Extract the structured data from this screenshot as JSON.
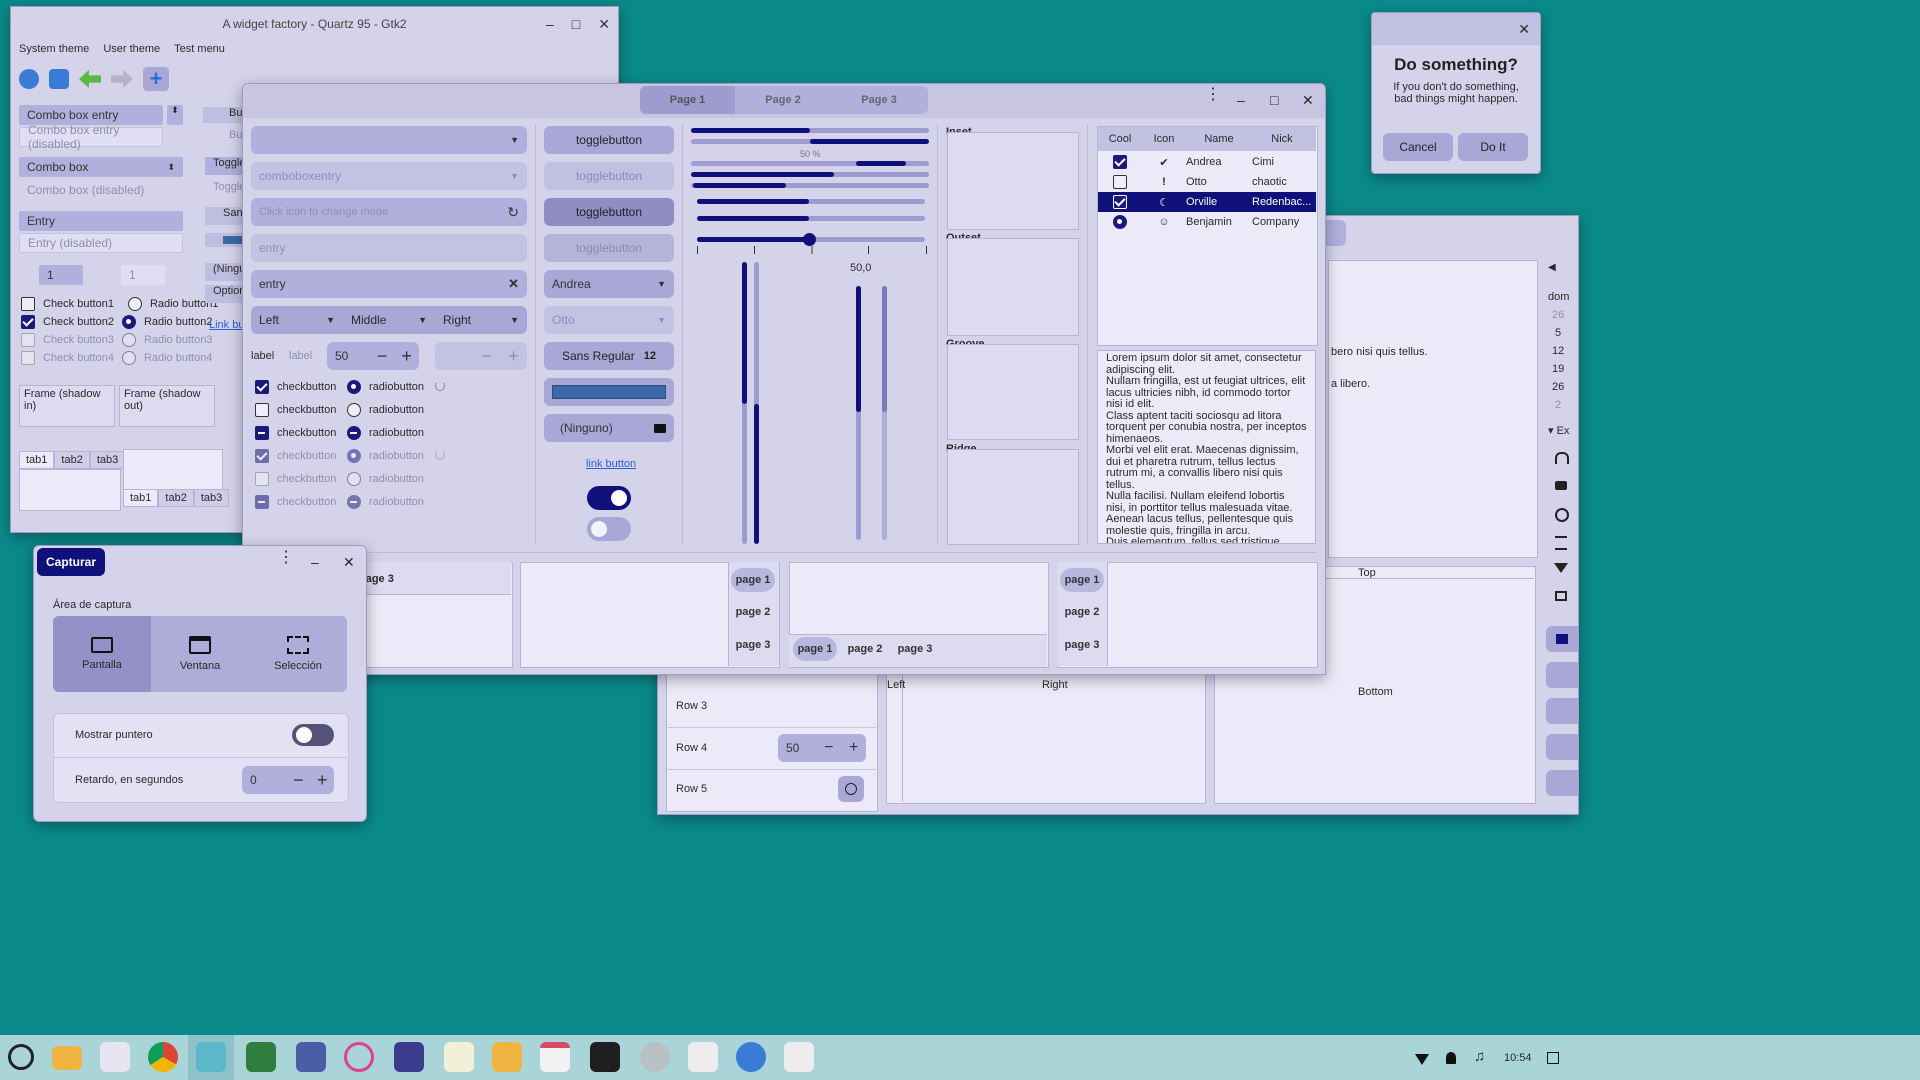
{
  "widget_factory": {
    "title": "A widget factory - Quartz 95 - Gtk2",
    "menu": [
      "System theme",
      "User theme",
      "Test menu"
    ],
    "combo_entry": "Combo box entry",
    "combo_entry_dis": "Combo box entry (disabled)",
    "combo": "Combo box",
    "combo_dis": "Combo box (disabled)",
    "entry": "Entry",
    "entry_dis": "Entry (disabled)",
    "spin1": "1",
    "spin2": "1",
    "checks": [
      "Check button1",
      "Check button2",
      "Check button3",
      "Check button4"
    ],
    "radios": [
      "Radio button1",
      "Radio button2",
      "Radio button3",
      "Radio button4"
    ],
    "frame_in": "Frame (shadow in)",
    "frame_out": "Frame (shadow out)",
    "tabs": [
      "tab1",
      "tab2",
      "tab3"
    ],
    "partial": [
      "Bu",
      "Bu",
      "Toggle",
      "Toggle",
      "San",
      "(Ningu",
      "Option",
      "Link bu"
    ]
  },
  "gtk4": {
    "tabs": [
      "Page 1",
      "Page 2",
      "Page 3"
    ],
    "col1": {
      "comboboxentry": "comboboxentry",
      "icon_entry_placeholder": "Click icon to change mode",
      "entry_placeholder": "entry",
      "entry_value": "entry",
      "align": [
        "Left",
        "Middle",
        "Right"
      ],
      "label1": "label",
      "label2": "label",
      "spin_value": "50",
      "check_label": "checkbutton",
      "radio_label": "radiobutton"
    },
    "col2": {
      "toggle": "togglebutton",
      "combo1": "Andrea",
      "combo2": "Otto",
      "font": "Sans Regular",
      "font_size": "12",
      "file": "(Ninguno)",
      "link": "link button"
    },
    "col3": {
      "progress_text": "50 %",
      "scale_value": "50,0"
    },
    "frames": [
      "Inset",
      "Outset",
      "Groove",
      "Ridge"
    ],
    "tree": {
      "headers": [
        "Cool",
        "Icon",
        "Name",
        "Nick"
      ],
      "rows": [
        {
          "name": "Andrea",
          "nick": "Cimi"
        },
        {
          "name": "Otto",
          "nick": "chaotic"
        },
        {
          "name": "Orville",
          "nick": "Redenbac..."
        },
        {
          "name": "Benjamin",
          "nick": "Company"
        }
      ]
    },
    "text": "Lorem ipsum dolor sit amet, consectetur adipiscing elit.\nNullam fringilla, est ut feugiat ultrices, elit lacus ultricies nibh, id commodo tortor nisi id elit.\nClass aptent taciti sociosqu ad litora torquent per conubia nostra, per inceptos himenaeos.\nMorbi vel elit erat. Maecenas dignissim, dui et pharetra rutrum, tellus lectus rutrum mi, a convallis libero nisi quis tellus.\nNulla facilisi. Nullam eleifend lobortis nisi, in porttitor tellus malesuada vitae.\nAenean lacus tellus, pellentesque quis molestie quis, fringilla in arcu.\nDuis elementum, tellus sed tristique semper, metus metus accumsan augue, et porttitor augue orci a libero.",
    "notebook_pages": [
      "page 1",
      "page 2",
      "page 3"
    ],
    "partial_page3": "page 3"
  },
  "dialog": {
    "title": "Do something?",
    "body": "If you don't do something,\nbad things might happen.",
    "cancel": "Cancel",
    "doit": "Do It"
  },
  "bg_window": {
    "text1": "bero nisi quis tellus.",
    "text2": "a libero.",
    "rows": [
      "Row 3",
      "Row 4",
      "Row 5"
    ],
    "spin_value": "50",
    "left": "Left",
    "right": "Right",
    "top": "Top",
    "bottom": "Bottom",
    "cal_header": "dom",
    "cal_days": [
      "26",
      "5",
      "12",
      "19",
      "26",
      "2"
    ],
    "expander": "Ex"
  },
  "capture": {
    "title": "Capturar",
    "area_label": "Área de captura",
    "modes": [
      "Pantalla",
      "Ventana",
      "Selección"
    ],
    "pointer": "Mostrar puntero",
    "delay": "Retardo, en segundos",
    "delay_value": "0"
  },
  "taskbar": {
    "time": "10:54"
  },
  "colors": {
    "accent": "#10107a",
    "bg": "#0b8a8a",
    "window": "#d5d3ea"
  }
}
